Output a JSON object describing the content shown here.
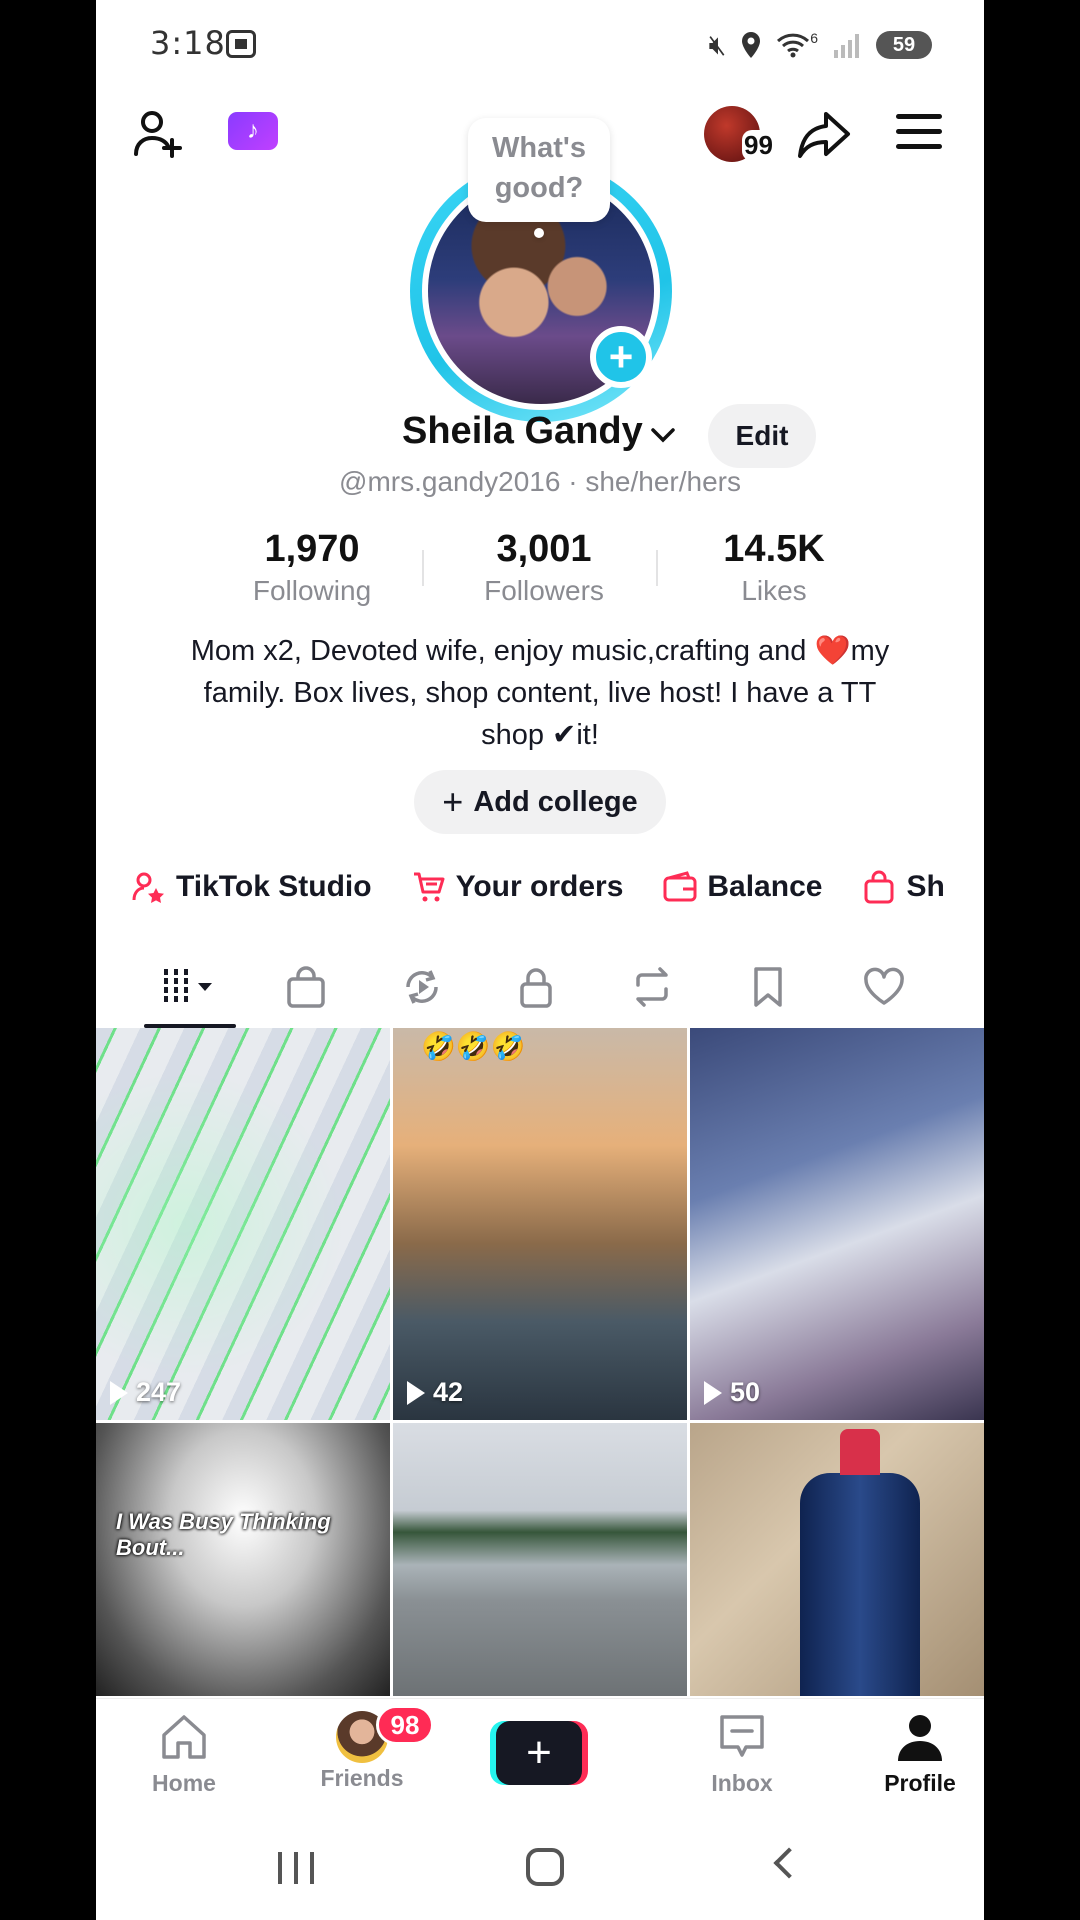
{
  "status_bar": {
    "time": "3:18",
    "battery": "59",
    "wifi_signal": "6",
    "icons": [
      "screenshot-icon",
      "mute-icon",
      "location-icon",
      "wifi-icon",
      "signal-icon",
      "battery-icon"
    ]
  },
  "top_nav": {
    "story_count": "99",
    "studio_icon_color": "#a03cff"
  },
  "profile": {
    "bubble_text": "What's good?",
    "display_name": "Sheila Gandy",
    "edit_label": "Edit",
    "handle": "@mrs.gandy2016 · she/her/hers",
    "stats": [
      {
        "value": "1,970",
        "label": "Following"
      },
      {
        "value": "3,001",
        "label": "Followers"
      },
      {
        "value": "14.5K",
        "label": "Likes"
      }
    ],
    "bio_part1": "Mom x2, Devoted wife, enjoy music,crafting and ",
    "bio_heart": "❤️",
    "bio_part2": "my family. Box lives, shop content, live host! I have a TT shop ",
    "bio_check": "✔",
    "bio_part3": "it!",
    "add_college_label": "Add college"
  },
  "quick_links": [
    {
      "label": "TikTok Studio",
      "icon": "studio-star-icon"
    },
    {
      "label": "Your orders",
      "icon": "cart-icon"
    },
    {
      "label": "Balance",
      "icon": "wallet-icon"
    },
    {
      "label": "Sh",
      "icon": "shop-bag-icon"
    }
  ],
  "accent_color": "#fe2c55",
  "tabs": [
    {
      "name": "videos-grid",
      "active": true
    },
    {
      "name": "shop-bag"
    },
    {
      "name": "reposts-spin"
    },
    {
      "name": "private-lock"
    },
    {
      "name": "reposts"
    },
    {
      "name": "favorites-bookmark"
    },
    {
      "name": "liked-heart"
    }
  ],
  "videos": [
    {
      "views": "247"
    },
    {
      "views": "42",
      "overlay": "🤣🤣🤣"
    },
    {
      "views": "50"
    },
    {
      "caption": "I Was Busy Thinking Bout..."
    },
    {},
    {}
  ],
  "bottom_nav": {
    "home": "Home",
    "friends": "Friends",
    "friends_badge": "98",
    "inbox": "Inbox",
    "profile": "Profile"
  }
}
